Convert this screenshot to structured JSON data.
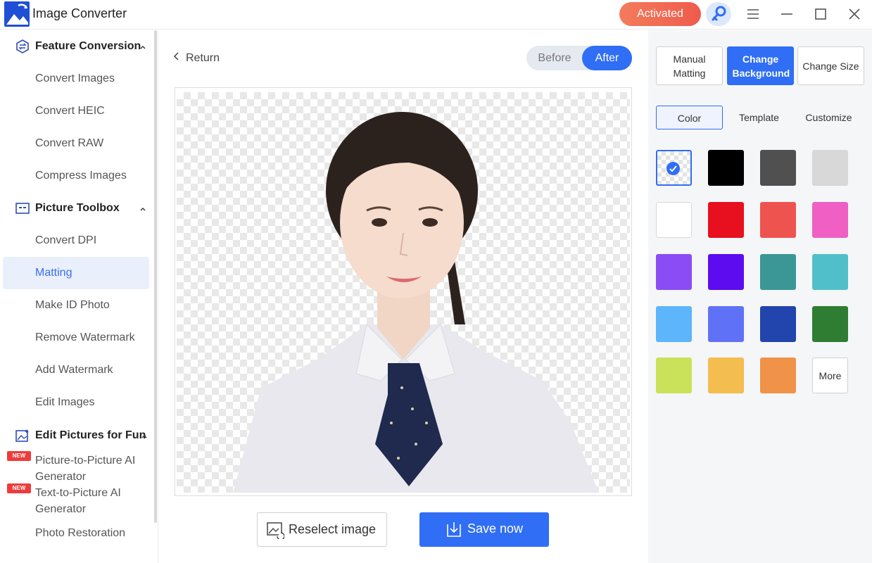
{
  "app": {
    "title": "Image Converter",
    "status": "Activated"
  },
  "sidebar": {
    "sections": [
      {
        "label": "Feature Conversion",
        "icon": "convert-icon"
      },
      {
        "label": "Picture Toolbox",
        "icon": "toolbox-icon"
      },
      {
        "label": "Edit Pictures for Fun",
        "icon": "magic-picture-icon"
      }
    ],
    "items": [
      {
        "label": "Convert Images"
      },
      {
        "label": "Convert HEIC"
      },
      {
        "label": "Convert RAW"
      },
      {
        "label": "Compress Images"
      },
      {
        "label": "Convert DPI"
      },
      {
        "label": "Matting",
        "active": true
      },
      {
        "label": "Make ID Photo"
      },
      {
        "label": "Remove Watermark"
      },
      {
        "label": "Add Watermark"
      },
      {
        "label": "Edit Images"
      },
      {
        "label": "Picture-to-Picture AI Generator",
        "badge": "NEW"
      },
      {
        "label": "Text-to-Picture AI Generator",
        "badge": "NEW"
      },
      {
        "label": "Photo Restoration"
      }
    ]
  },
  "main": {
    "return_label": "Return",
    "compare": {
      "before": "Before",
      "after": "After",
      "selected": "After"
    },
    "reselect_label": "Reselect image",
    "save_label": "Save now"
  },
  "panel": {
    "modes": [
      {
        "label": "Manual Matting",
        "active": false
      },
      {
        "label": "Change Background",
        "active": true
      },
      {
        "label": "Change Size",
        "active": false
      }
    ],
    "tabs": [
      {
        "label": "Color",
        "active": true
      },
      {
        "label": "Template",
        "active": false
      },
      {
        "label": "Customize",
        "active": false
      }
    ],
    "swatches": [
      "transparent",
      "#000000",
      "#505050",
      "#d8d8d8",
      "#ffffff",
      "#e8101e",
      "#ef5350",
      "#ef5fc4",
      "#8a4cf5",
      "#5d0cf0",
      "#3a9795",
      "#51bfca",
      "#5db5fb",
      "#5f72f7",
      "#2144ad",
      "#2e7d32",
      "#c9e25a",
      "#f4bd4f",
      "#f09349"
    ],
    "selected_swatch": "transparent",
    "more_label": "More"
  }
}
